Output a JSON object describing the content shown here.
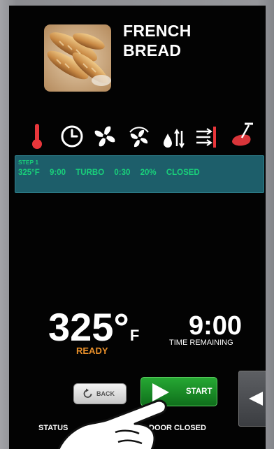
{
  "recipe": {
    "title_line1": "FRENCH",
    "title_line2": "BREAD",
    "image_icon": "bread-photo"
  },
  "parameter_icons": [
    "thermometer-icon",
    "clock-icon",
    "turbo-fan-icon",
    "fan-icon",
    "moisture-icon",
    "vent-icon",
    "meat-probe-icon"
  ],
  "step": {
    "label": "STEP 1",
    "temperature": "325°F",
    "time": "9:00",
    "fan_mode": "TURBO",
    "fan_time": "0:30",
    "humidity": "20%",
    "vent": "CLOSED"
  },
  "display": {
    "temperature_value": "325°",
    "temperature_unit": "F",
    "temperature_status": "READY",
    "time_remaining": "9:00",
    "time_label": "TIME REMAINING"
  },
  "buttons": {
    "back_label": "BACK",
    "start_label": "START",
    "side_icon": "left-arrow-icon"
  },
  "status_bar": {
    "status_label": "STATUS",
    "door_label": "DOOR CLOSED"
  },
  "colors": {
    "step_text": "#19d07a",
    "ready": "#e88f2a",
    "start_button": "#1b8f28",
    "step_panel": "#1d5e6a"
  }
}
